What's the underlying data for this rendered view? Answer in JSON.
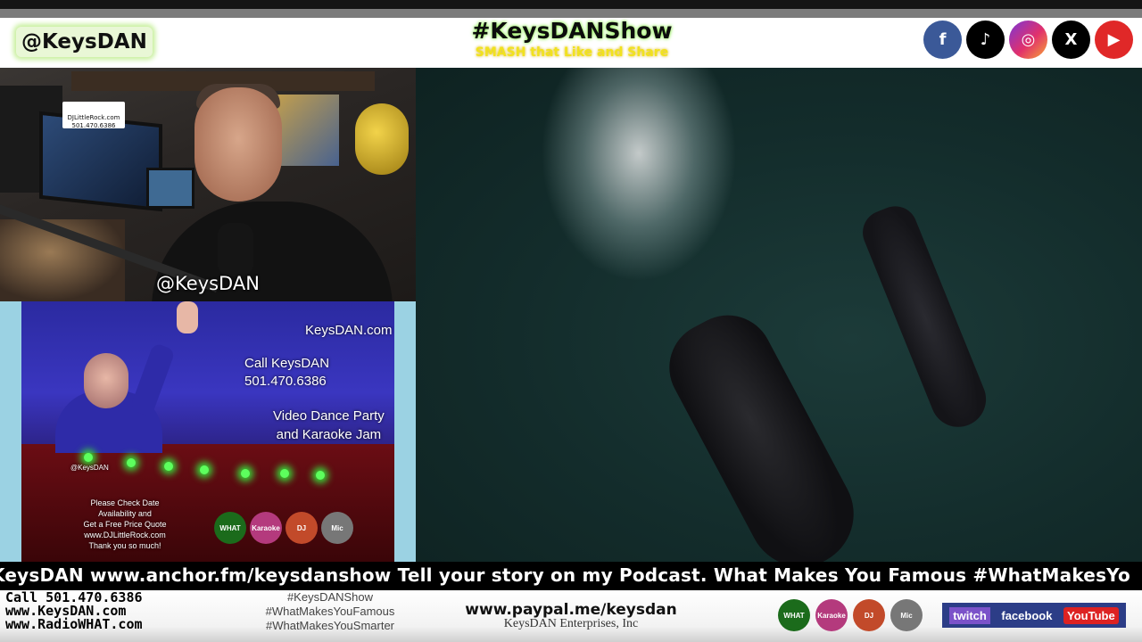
{
  "header": {
    "handle": "@KeysDAN",
    "show_title": "#KeysDANShow",
    "show_subtitle": "SMASH that Like and Share",
    "socials": [
      {
        "icon": "facebook-icon",
        "glyph": "f"
      },
      {
        "icon": "tiktok-icon",
        "glyph": "♪"
      },
      {
        "icon": "instagram-icon",
        "glyph": "◎"
      },
      {
        "icon": "x-icon",
        "glyph": "X"
      },
      {
        "icon": "youtube-icon",
        "glyph": "▶"
      }
    ]
  },
  "webcam": {
    "handle_overlay": "@KeysDAN",
    "sticker_text": "DJLittleRock.com 501.470.6386"
  },
  "promo": {
    "site": "KeysDAN.com",
    "call_line1": "Call KeysDAN",
    "call_line2": "501.470.6386",
    "party_line1": "Video Dance Party",
    "party_line2": "and Karaoke Jam",
    "handle": "@KeysDAN",
    "check_line1": "Please Check Date",
    "check_line2": "Availability and",
    "check_line3": "Get a Free Price Quote",
    "check_line4": "www.DJLittleRock.com",
    "check_line5": "Thank you so much!",
    "logos": [
      "WHAT",
      "Karaoke",
      "DJ",
      "Mic"
    ]
  },
  "ticker": {
    "text": "KeysDAN www.anchor.fm/keysdanshow  Tell your story on my Podcast. What Makes You Famous #WhatMakesYo"
  },
  "footer": {
    "call": "Call 501.470.6386",
    "site1": "www.KeysDAN.com",
    "site2": "www.RadioWHAT.com",
    "tag1": "#KeysDANShow",
    "tag2": "#WhatMakesYouFamous",
    "tag3": "#WhatMakesYouSmarter",
    "paypal": "www.paypal.me/keysdan",
    "enterprises": "KeysDAN Enterprises, Inc",
    "logos": [
      "WHAT",
      "Karaoke",
      "DJ",
      "Mic"
    ],
    "brands": [
      "twitch",
      "facebook",
      "YouTube"
    ]
  },
  "colors": {
    "header_bg": "#ffffff",
    "title_glow": "#9ff06a",
    "subtitle": "#f1e21e",
    "ocean": "#132c2b",
    "ticker_bg": "#000000",
    "brands_bar": "#2c3d87"
  }
}
